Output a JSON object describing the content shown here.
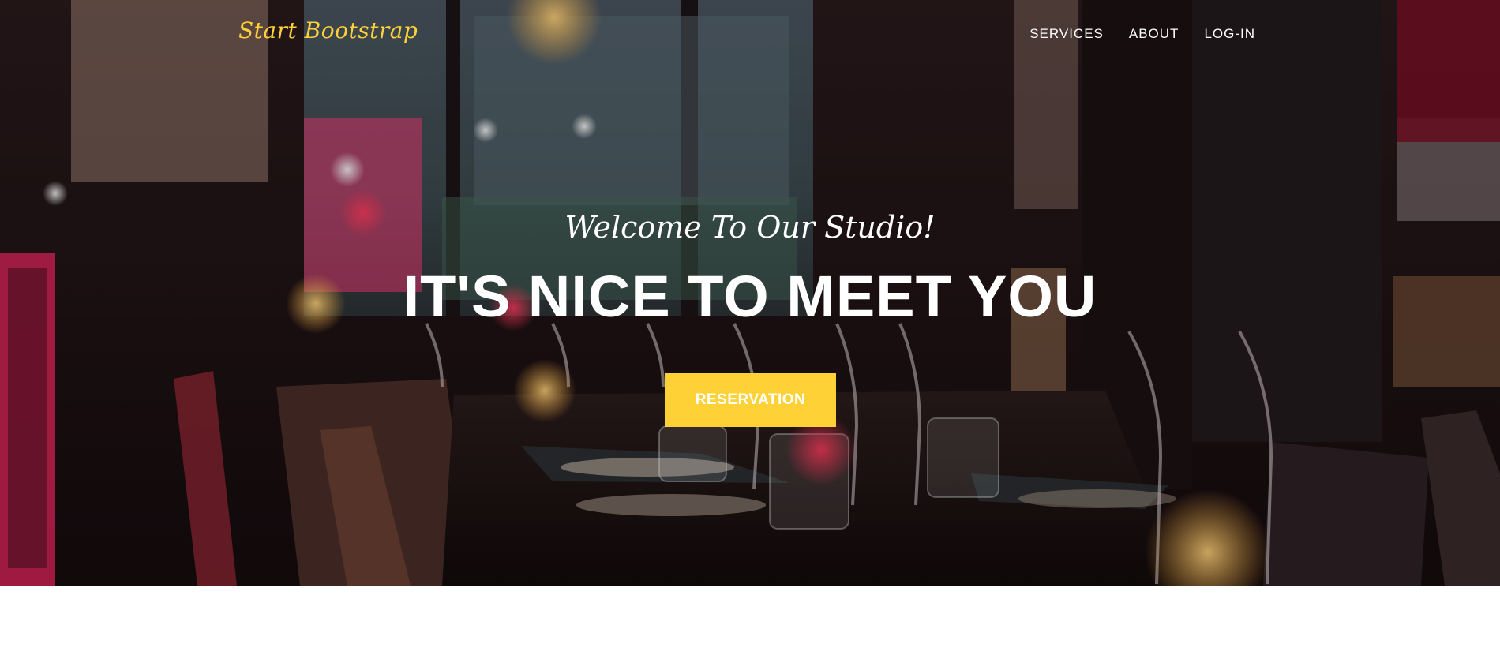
{
  "navbar": {
    "brand": "Start Bootstrap",
    "links": [
      {
        "label": "SERVICES"
      },
      {
        "label": "ABOUT"
      },
      {
        "label": "LOG-IN"
      }
    ]
  },
  "hero": {
    "subheading": "Welcome To Our Studio!",
    "heading": "IT'S NICE TO MEET YOU",
    "button_label": "RESERVATION",
    "background_scene": "restaurant-interior-photo"
  },
  "colors": {
    "accent": "#fed136",
    "text_light": "#ffffff",
    "page_background": "#ffffff"
  }
}
